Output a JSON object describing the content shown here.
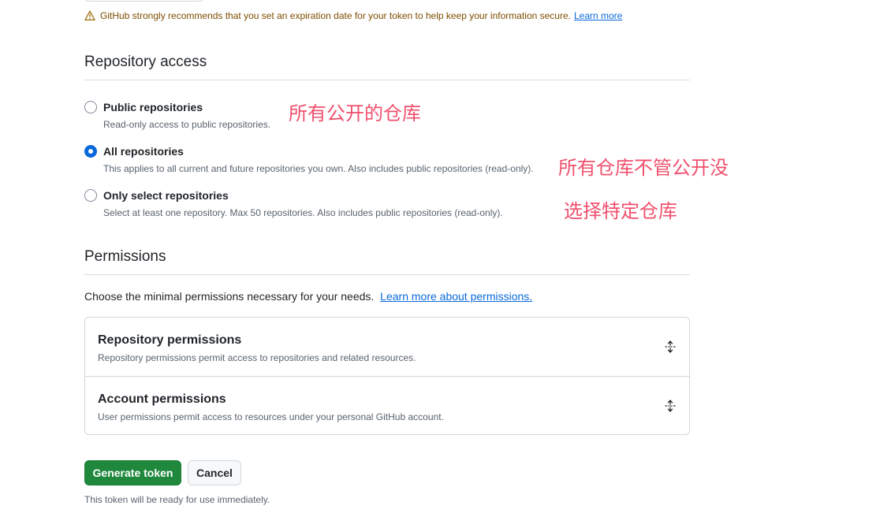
{
  "warning": {
    "text": "GitHub strongly recommends that you set an expiration date for your token to help keep your information secure.",
    "link": "Learn more",
    "icon": "alert-icon"
  },
  "repository_access": {
    "title": "Repository access",
    "options": [
      {
        "label": "Public repositories",
        "description": "Read-only access to public repositories.",
        "checked": false
      },
      {
        "label": "All repositories",
        "description": "This applies to all current and future repositories you own. Also includes public repositories (read-only).",
        "checked": true
      },
      {
        "label": "Only select repositories",
        "description": "Select at least one repository. Max 50 repositories. Also includes public repositories (read-only).",
        "checked": false
      }
    ]
  },
  "annotations": [
    "所有公开的仓库",
    "所有仓库不管公开没",
    "选择特定仓库"
  ],
  "permissions": {
    "title": "Permissions",
    "intro": "Choose the minimal permissions necessary for your needs.",
    "intro_link": "Learn more about permissions.",
    "groups": [
      {
        "title": "Repository permissions",
        "description": "Repository permissions permit access to repositories and related resources."
      },
      {
        "title": "Account permissions",
        "description": "User permissions permit access to resources under your personal GitHub account."
      }
    ]
  },
  "actions": {
    "generate_label": "Generate token",
    "cancel_label": "Cancel",
    "note": "This token will be ready for use immediately."
  },
  "colors": {
    "primary_green": "#1f883d",
    "link_blue": "#0969da",
    "annotation_red": "#f0506e",
    "warning_text": "#7d4e00"
  }
}
